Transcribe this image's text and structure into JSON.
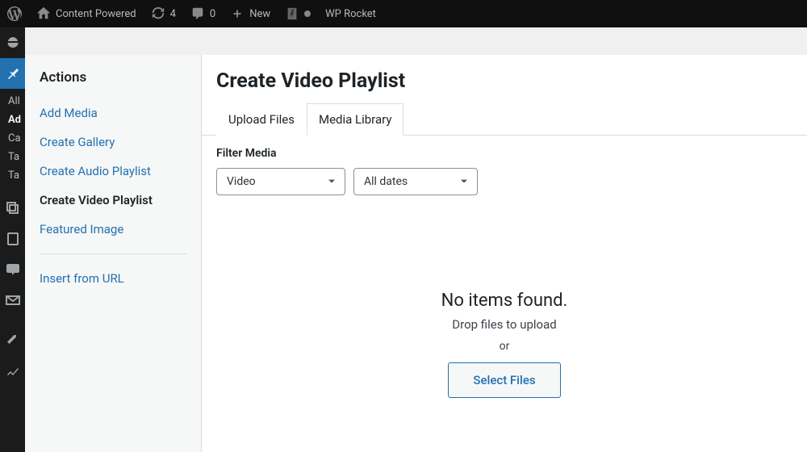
{
  "admin_bar": {
    "site_name": "Content Powered",
    "updates_count": "4",
    "comments_count": "0",
    "new_label": "New",
    "wp_rocket": "WP Rocket"
  },
  "wp_sidebar": {
    "items": [
      "All",
      "Ad",
      "Ca",
      "Ta",
      "Ta"
    ]
  },
  "actions": {
    "heading": "Actions",
    "links": [
      {
        "label": "Add Media",
        "active": false
      },
      {
        "label": "Create Gallery",
        "active": false
      },
      {
        "label": "Create Audio Playlist",
        "active": false
      },
      {
        "label": "Create Video Playlist",
        "active": true
      },
      {
        "label": "Featured Image",
        "active": false
      }
    ],
    "insert_url": "Insert from URL"
  },
  "media": {
    "title": "Create Video Playlist",
    "tabs": [
      {
        "label": "Upload Files",
        "active": false
      },
      {
        "label": "Media Library",
        "active": true
      }
    ],
    "filter_label": "Filter Media",
    "filter_type": "Video",
    "filter_date": "All dates",
    "empty_title": "No items found.",
    "empty_sub": "Drop files to upload",
    "empty_or": "or",
    "select_files": "Select Files"
  }
}
